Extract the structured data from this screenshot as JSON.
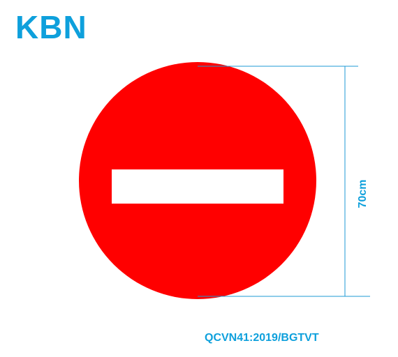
{
  "brand": {
    "text": "KBN"
  },
  "sign": {
    "type": "no-entry",
    "circle_color": "#ff0000",
    "bar_color": "#ffffff"
  },
  "dimension": {
    "label": "70cm",
    "line_color": "#1e9ad6"
  },
  "standard": {
    "text": "QCVN41:2019/BGTVT"
  },
  "colors": {
    "accent": "#0ea0dc",
    "background": "#ffffff"
  }
}
